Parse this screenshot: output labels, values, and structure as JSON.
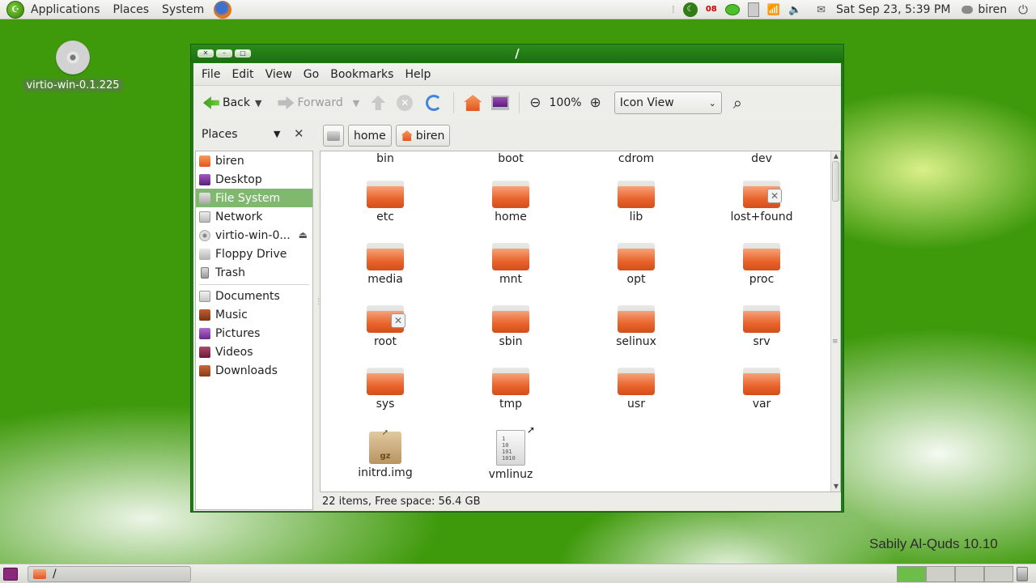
{
  "top_panel": {
    "menus": [
      "Applications",
      "Places",
      "System"
    ],
    "indicator_number": "08",
    "clock": "Sat Sep 23,  5:39 PM",
    "user": "biren"
  },
  "desktop": {
    "icon_label": "virtio-win-0.1.225",
    "branding": "Sabily Al-Quds 10.10"
  },
  "window": {
    "title": "/",
    "menu": [
      "File",
      "Edit",
      "View",
      "Go",
      "Bookmarks",
      "Help"
    ],
    "toolbar": {
      "back": "Back",
      "forward": "Forward",
      "zoom": "100%",
      "view_mode": "Icon View"
    },
    "places_label": "Places",
    "breadcrumbs": [
      "home",
      "biren"
    ],
    "sidebar": {
      "group1": [
        "biren",
        "Desktop",
        "File System",
        "Network",
        "virtio-win-0...",
        "Floppy Drive",
        "Trash"
      ],
      "group2": [
        "Documents",
        "Music",
        "Pictures",
        "Videos",
        "Downloads"
      ],
      "active": "File System"
    },
    "files": {
      "top_partial": [
        "bin",
        "boot",
        "cdrom",
        "dev"
      ],
      "rows": [
        [
          "etc",
          "home",
          "lib",
          "lost+found"
        ],
        [
          "media",
          "mnt",
          "opt",
          "proc"
        ],
        [
          "root",
          "sbin",
          "selinux",
          "srv"
        ],
        [
          "sys",
          "tmp",
          "usr",
          "var"
        ]
      ],
      "last_row": [
        "initrd.img",
        "vmlinuz"
      ],
      "pkg_label": "gz",
      "bin_lines": [
        "1",
        "10",
        "101",
        "1010"
      ]
    },
    "status": "22 items, Free space: 56.4 GB"
  },
  "bottom_panel": {
    "task_title": "/"
  }
}
